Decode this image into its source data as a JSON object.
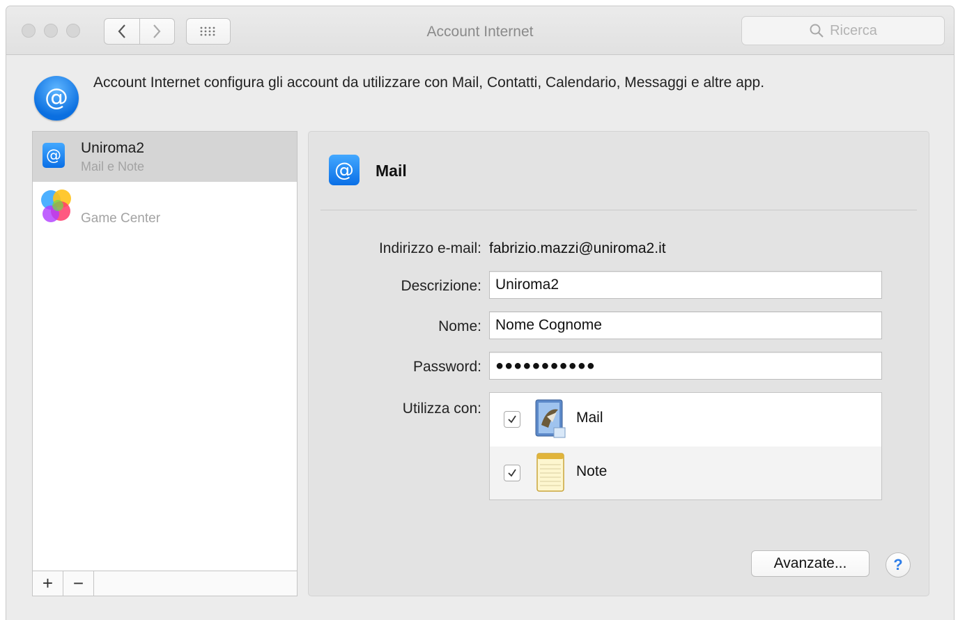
{
  "window": {
    "title": "Account Internet",
    "search_placeholder": "Ricerca"
  },
  "header": {
    "icon": "at-icon",
    "description": "Account Internet configura gli account da utilizzare con Mail, Contatti, Calendario, Messaggi e altre app."
  },
  "sidebar": {
    "accounts": [
      {
        "name": "Uniroma2",
        "subtitle": "Mail e Note",
        "icon": "at-icon",
        "selected": true
      },
      {
        "name": "",
        "subtitle": "Game Center",
        "icon": "game-center-icon",
        "selected": false
      }
    ],
    "add_label": "+",
    "remove_label": "−"
  },
  "panel": {
    "title": "Mail",
    "email_label": "Indirizzo e-mail:",
    "email_value": "fabrizio.mazzi@uniroma2.it",
    "description_label": "Descrizione:",
    "description_value": "Uniroma2",
    "name_label": "Nome:",
    "name_value": "Nome Cognome",
    "password_label": "Password:",
    "password_value": "●●●●●●●●●●●",
    "use_with_label": "Utilizza con:",
    "apps": [
      {
        "label": "Mail",
        "checked": true,
        "icon": "mail-app-icon"
      },
      {
        "label": "Note",
        "checked": true,
        "icon": "notes-app-icon"
      }
    ],
    "advanced_label": "Avanzate...",
    "help_label": "?"
  },
  "colors": {
    "accent": "#0a6fe6",
    "selection": "#d5d5d5",
    "window_bg": "#ececec"
  }
}
